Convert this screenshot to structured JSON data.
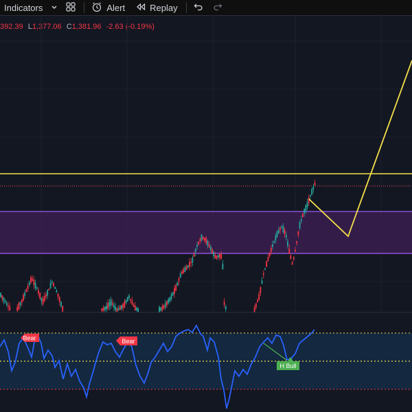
{
  "toolbar": {
    "indicators_label": "Indicators",
    "alert_label": "Alert",
    "replay_label": "Replay",
    "icons": [
      "chevron-down-icon",
      "templates-grid-icon",
      "alert-clock-icon",
      "replay-rewind-icon",
      "undo-icon",
      "redo-icon"
    ]
  },
  "legend": {
    "h_value": "392.39",
    "l_key": "L",
    "l_value": "1,377.06",
    "c_key": "C",
    "c_value": "1,381.96",
    "change": "-2.63 (-0.19%)"
  },
  "oscillator": {
    "labels": [
      "Bear",
      "Bear",
      "H Bull"
    ]
  },
  "colors": {
    "background": "#131722",
    "toolbar": "#0f0f0f",
    "bull": "#26a69a",
    "bear": "#f23645",
    "zone": "#3a1f4f",
    "zone_border": "#8b4fd6",
    "resistance": "#f5e04a",
    "projection": "#f5e04a",
    "oscillator_line": "#2962ff",
    "oscillator_band": "#152a42",
    "bull_label": "#4caf50"
  }
}
